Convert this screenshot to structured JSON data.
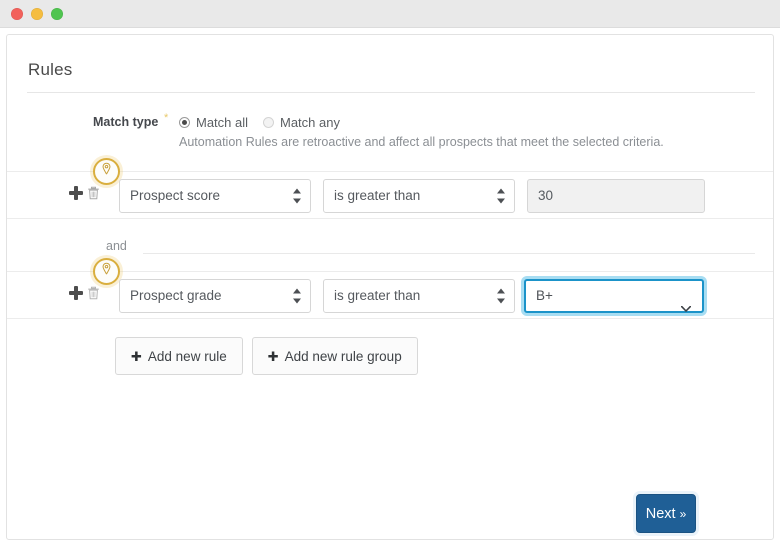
{
  "window": {
    "traffic_lights": [
      "close-red",
      "minimize-yellow",
      "maximize-green"
    ]
  },
  "card": {
    "title": "Rules"
  },
  "match_type": {
    "label": "Match type",
    "required_marker": "*",
    "options": [
      {
        "label": "Match all",
        "selected": true
      },
      {
        "label": "Match any",
        "selected": false
      }
    ],
    "description": "Automation Rules are retroactive and affect all prospects that meet the selected criteria."
  },
  "separator": {
    "and_label": "and"
  },
  "rules": [
    {
      "field": "Prospect score",
      "operator": "is greater than",
      "value": "30",
      "value_kind": "text",
      "focused": false,
      "marker_icon": "location-pin-icon"
    },
    {
      "field": "Prospect grade",
      "operator": "is greater than",
      "value": "B+",
      "value_kind": "select",
      "focused": true,
      "marker_icon": "location-pin-icon"
    }
  ],
  "actions": {
    "add_rule_label": "Add new rule",
    "add_rule_group_label": "Add new rule group",
    "plus_glyph": "✚"
  },
  "footer": {
    "next_label": "Next",
    "next_chevrons": "»"
  },
  "colors": {
    "focus_border": "#1b93c9",
    "focus_glow": "#a8ddf2",
    "marker_ring": "#d9ae3e",
    "primary_button": "#1f5f96",
    "required_asterisk": "#e8c96a"
  }
}
